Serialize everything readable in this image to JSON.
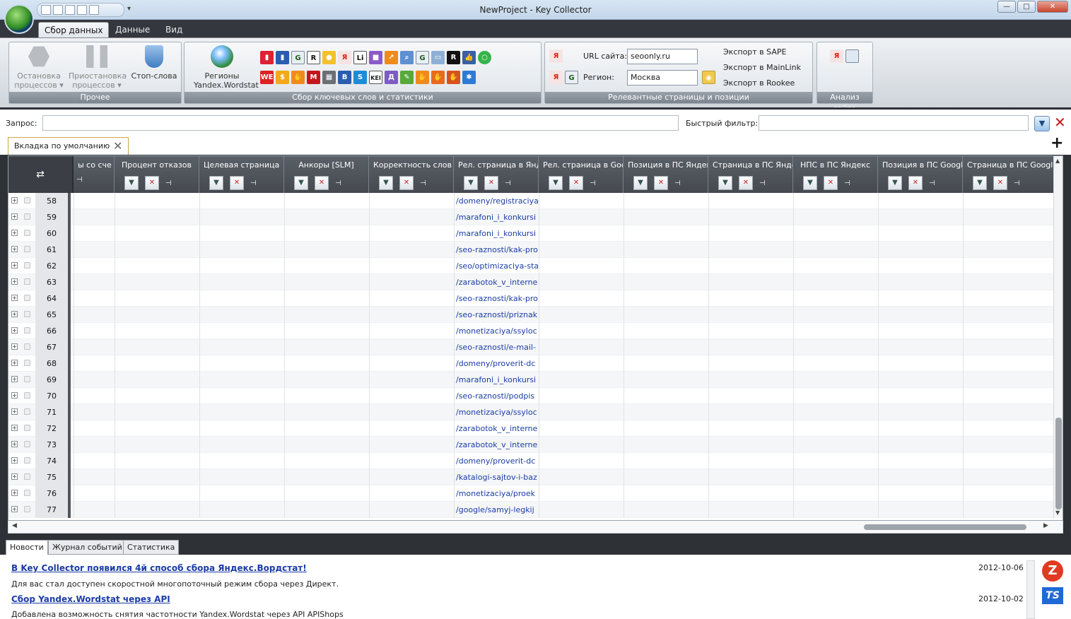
{
  "window": {
    "title": "NewProject - Key Collector",
    "min": "—",
    "max": "□",
    "close": "✕"
  },
  "qat": {
    "dropdown": "▾"
  },
  "ribbon_tabs": [
    "Сбор данных",
    "Данные",
    "Вид"
  ],
  "ribbon": {
    "group_other": {
      "label": "Прочее",
      "stop": "Остановка процессов ▾",
      "pause": "Приостановка процессов ▾",
      "stopwords": "Стоп-слова"
    },
    "group_collect": {
      "label": "Сбор ключевых слов и статистики",
      "regions": "Регионы Yandex.Wordstat"
    },
    "group_relevant": {
      "label": "Релевантные страницы и позиции",
      "url_label": "URL сайта:",
      "url_value": "seoonly.ru",
      "region_label": "Регион:",
      "region_value": "Москва",
      "export_sape": "Экспорт в SAPE",
      "export_mainlink": "Экспорт в MainLink",
      "export_rookee": "Экспорт в Rookee"
    },
    "group_analysis": {
      "label": "Анализ сайта"
    }
  },
  "query": {
    "label": "Запрос:",
    "value": "",
    "quick_filter_label": "Быстрый фильтр:",
    "quick_filter_value": ""
  },
  "doc_tab": {
    "label": "Вкладка по умолчанию"
  },
  "columns": [
    "ы со сче",
    "Процент отказов",
    "Целевая страница",
    "Анкоры [SLM]",
    "Корректность слов",
    "Рел. страница в Яндексе",
    "Рел. страница в Google",
    "Позиция в ПС Яндекс",
    "Страница в ПС Яндекс",
    "НПС в ПС Яндекс",
    "Позиция в ПС Google",
    "Страница в ПС Google"
  ],
  "rows": [
    {
      "n": "58",
      "url": "/domeny/registraciya"
    },
    {
      "n": "59",
      "url": "/marafoni_i_konkursi"
    },
    {
      "n": "60",
      "url": "/marafoni_i_konkursi"
    },
    {
      "n": "61",
      "url": "/seo-raznosti/kak-pro"
    },
    {
      "n": "62",
      "url": "/seo/optimizaciya-sta"
    },
    {
      "n": "63",
      "url": "/zarabotok_v_interne"
    },
    {
      "n": "64",
      "url": "/seo-raznosti/kak-pro"
    },
    {
      "n": "65",
      "url": "/seo-raznosti/priznak"
    },
    {
      "n": "66",
      "url": "/monetizaciya/ssyloc"
    },
    {
      "n": "67",
      "url": "/seo-raznosti/e-mail-"
    },
    {
      "n": "68",
      "url": "/domeny/proverit-dc"
    },
    {
      "n": "69",
      "url": "/marafoni_i_konkursi"
    },
    {
      "n": "70",
      "url": "/seo-raznosti/podpis"
    },
    {
      "n": "71",
      "url": "/monetizaciya/ssyloc"
    },
    {
      "n": "72",
      "url": "/zarabotok_v_interne"
    },
    {
      "n": "73",
      "url": "/zarabotok_v_interne"
    },
    {
      "n": "74",
      "url": "/domeny/proverit-dc"
    },
    {
      "n": "75",
      "url": "/katalogi-sajtov-i-baz"
    },
    {
      "n": "76",
      "url": "/monetizaciya/proek"
    },
    {
      "n": "77",
      "url": "/google/samyj-legkij"
    }
  ],
  "bottom_tabs": [
    "Новости",
    "Журнал событий",
    "Статистика"
  ],
  "news": [
    {
      "title": "В Key Collector появился 4й способ сбора Яндекс.Вордстат!",
      "date": "2012-10-06",
      "text": "Для вас стал доступен  скоростной многопоточный режим сбора через Директ."
    },
    {
      "title": "Сбор Yandex.Wordstat через API",
      "date": "2012-10-02",
      "text": "Добавлена возможность снятия  частотности Yandex.Wordstat через API APIShops"
    }
  ],
  "colors": {
    "accent": "#1a3ca6",
    "header_bg": "#45494f",
    "danger": "#c0181a"
  }
}
